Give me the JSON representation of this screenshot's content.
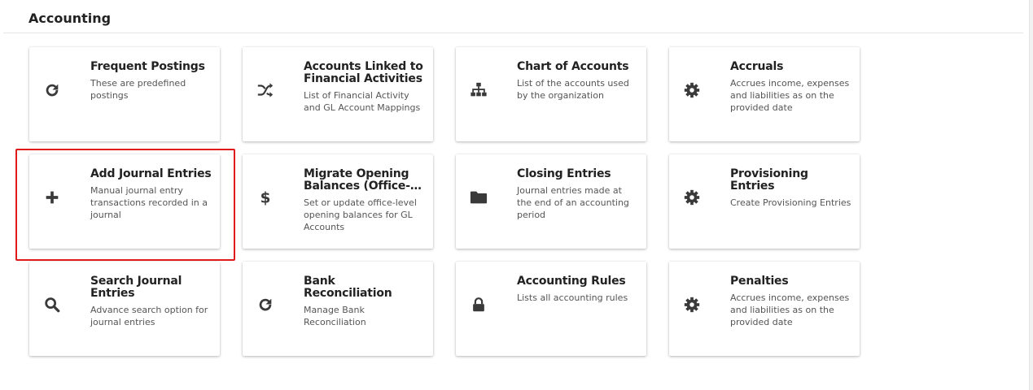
{
  "page": {
    "title": "Accounting"
  },
  "highlight_color": "#e0191b",
  "cards": [
    {
      "title": "Frequent Postings",
      "description": "These are predefined postings",
      "icon": "refresh-icon"
    },
    {
      "title": "Accounts Linked to Financial Activities",
      "description": "List of Financial Activity and GL Account Mappings",
      "icon": "shuffle-icon"
    },
    {
      "title": "Chart of Accounts",
      "description": "List of the accounts used by the organization",
      "icon": "sitemap-icon"
    },
    {
      "title": "Accruals",
      "description": "Accrues income, expenses and liabilities as on the provided date",
      "icon": "gear-icon"
    },
    {
      "title": "Add Journal Entries",
      "description": "Manual journal entry transactions recorded in a journal",
      "icon": "plus-icon",
      "highlighted": true
    },
    {
      "title": "Migrate Opening Balances (Office-…",
      "description": "Set or update office-level opening balances for GL Accounts",
      "icon": "dollar-icon"
    },
    {
      "title": "Closing Entries",
      "description": "Journal entries made at the end of an accounting period",
      "icon": "folder-icon"
    },
    {
      "title": "Provisioning Entries",
      "description": "Create Provisioning Entries",
      "icon": "gear-icon"
    },
    {
      "title": "Search Journal Entries",
      "description": "Advance search option for journal entries",
      "icon": "search-icon"
    },
    {
      "title": "Bank Reconciliation",
      "description": "Manage Bank Reconciliation",
      "icon": "refresh-icon"
    },
    {
      "title": "Accounting Rules",
      "description": "Lists all accounting rules",
      "icon": "lock-icon"
    },
    {
      "title": "Penalties",
      "description": "Accrues income, expenses and liabilities as on the provided date",
      "icon": "gear-icon"
    }
  ]
}
